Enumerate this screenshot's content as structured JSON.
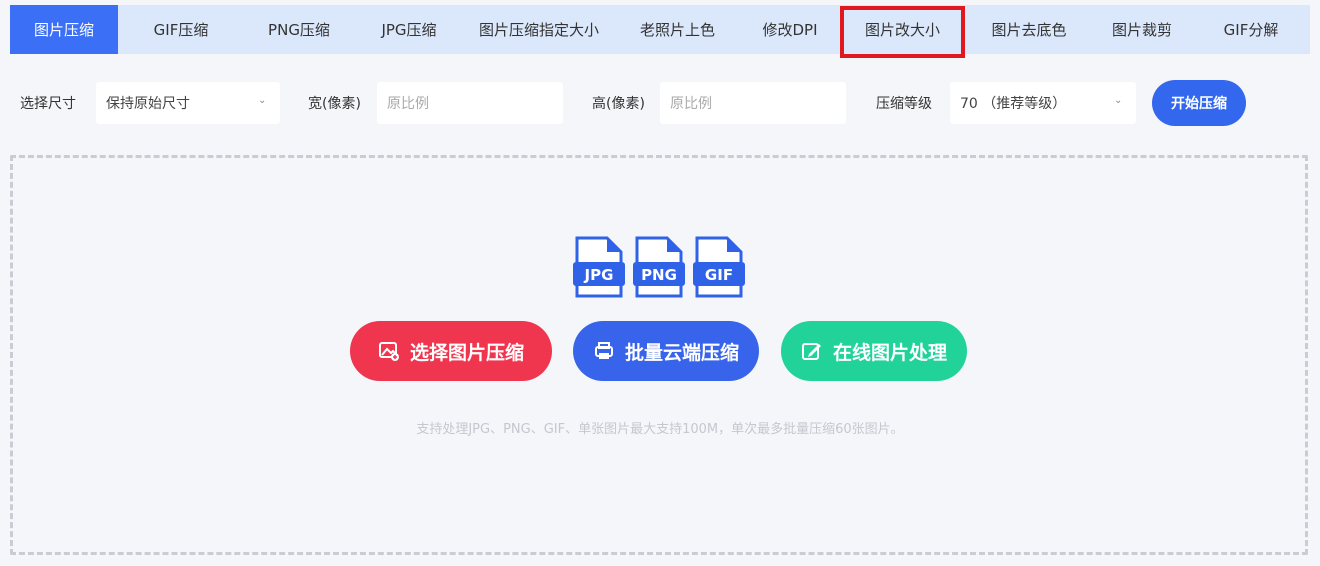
{
  "tabs": [
    {
      "label": "图片压缩",
      "name": "tab-image-compress",
      "active": true
    },
    {
      "label": "GIF压缩",
      "name": "tab-gif-compress"
    },
    {
      "label": "PNG压缩",
      "name": "tab-png-compress"
    },
    {
      "label": "JPG压缩",
      "name": "tab-jpg-compress"
    },
    {
      "label": "图片压缩指定大小",
      "name": "tab-compress-to-size"
    },
    {
      "label": "老照片上色",
      "name": "tab-colorize-old-photo"
    },
    {
      "label": "修改DPI",
      "name": "tab-modify-dpi"
    },
    {
      "label": "图片改大小",
      "name": "tab-resize-image",
      "highlight": true
    },
    {
      "label": "图片去底色",
      "name": "tab-remove-background"
    },
    {
      "label": "图片裁剪",
      "name": "tab-crop-image"
    },
    {
      "label": "GIF分解",
      "name": "tab-gif-split"
    }
  ],
  "options": {
    "size_label": "选择尺寸",
    "size_value": "保持原始尺寸",
    "width_label": "宽(像素)",
    "width_placeholder": "原比例",
    "height_label": "高(像素)",
    "height_placeholder": "原比例",
    "level_label": "压缩等级",
    "level_value": "70 （推荐等级）",
    "start_label": "开始压缩"
  },
  "dropzone": {
    "file_types": [
      "JPG",
      "PNG",
      "GIF"
    ],
    "select_button": "选择图片压缩",
    "batch_button": "批量云端压缩",
    "online_button": "在线图片处理",
    "hint": "支持处理JPG、PNG、GIF、单张图片最大支持100M，单次最多批量压缩60张图片。"
  },
  "colors": {
    "accent": "#3b6ff5",
    "select_btn": "#f0354f",
    "batch_btn": "#3764ea",
    "online_btn": "#22d399",
    "highlight_border": "#e0191f"
  }
}
